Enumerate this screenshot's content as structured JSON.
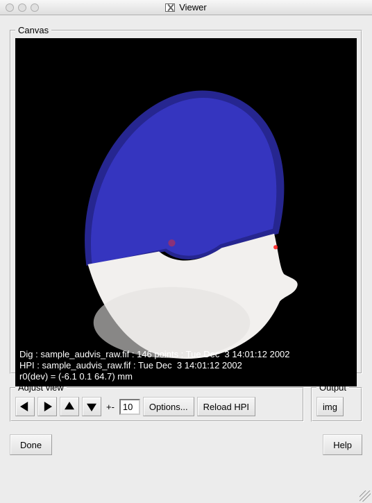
{
  "window": {
    "title": "Viewer"
  },
  "canvas": {
    "legend": "Canvas",
    "status": "Dig : sample_audvis_raw.fif : 146 points : Tue Dec  3 14:01:12 2002\nHPI : sample_audvis_raw.fif : Tue Dec  3 14:01:12 2002\nr0(dev) = (-6.1 0.1 64.7) mm"
  },
  "adjust_view": {
    "legend": "Adjust view",
    "plusminus": "+-",
    "step": "10",
    "options": "Options...",
    "reload": "Reload HPI"
  },
  "output": {
    "legend": "Output",
    "img_label": "img"
  },
  "buttons": {
    "done": "Done",
    "help": "Help"
  }
}
